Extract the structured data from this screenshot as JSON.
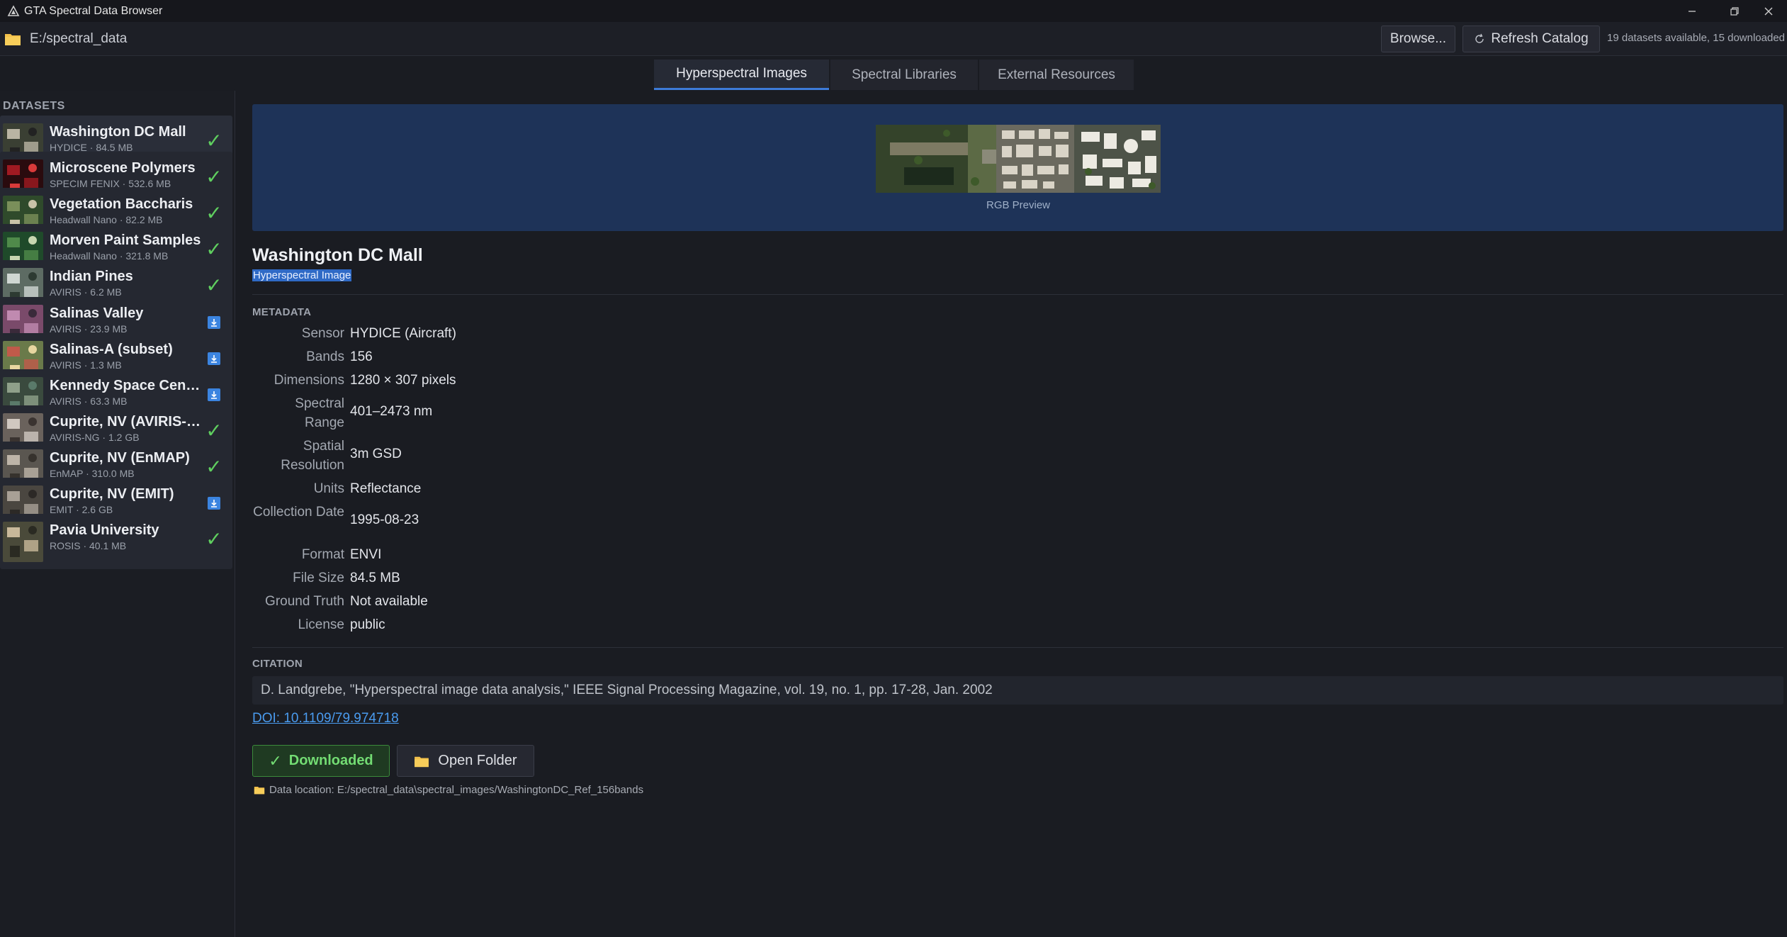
{
  "window": {
    "title": "GTA Spectral Data Browser"
  },
  "toolbar": {
    "path": "E:/spectral_data",
    "browse_label": "Browse...",
    "refresh_label": "Refresh Catalog",
    "status": "19 datasets available, 15 downloaded"
  },
  "tabs": [
    {
      "label": "Hyperspectral Images",
      "active": true
    },
    {
      "label": "Spectral Libraries",
      "active": false
    },
    {
      "label": "External Resources",
      "active": false
    }
  ],
  "sidebar": {
    "heading": "DATASETS",
    "items": [
      {
        "name": "Washington DC Mall",
        "meta": "HYDICE · 84.5 MB",
        "status": "downloaded",
        "selected": true
      },
      {
        "name": "Microscene Polymers",
        "meta": "SPECIM FENIX · 532.6 MB",
        "status": "downloaded"
      },
      {
        "name": "Vegetation Baccharis",
        "meta": "Headwall Nano · 82.2 MB",
        "status": "downloaded"
      },
      {
        "name": "Morven Paint Samples",
        "meta": "Headwall Nano · 321.8 MB",
        "status": "downloaded"
      },
      {
        "name": "Indian Pines",
        "meta": "AVIRIS · 6.2 MB",
        "status": "downloaded"
      },
      {
        "name": "Salinas Valley",
        "meta": "AVIRIS · 23.9 MB",
        "status": "download"
      },
      {
        "name": "Salinas-A (subset)",
        "meta": "AVIRIS · 1.3 MB",
        "status": "download"
      },
      {
        "name": "Kennedy Space Center",
        "meta": "AVIRIS · 63.3 MB",
        "status": "download"
      },
      {
        "name": "Cuprite, NV (AVIRIS-NG)",
        "meta": "AVIRIS-NG · 1.2 GB",
        "status": "downloaded"
      },
      {
        "name": "Cuprite, NV (EnMAP)",
        "meta": "EnMAP · 310.0 MB",
        "status": "downloaded"
      },
      {
        "name": "Cuprite, NV (EMIT)",
        "meta": "EMIT · 2.6 GB",
        "status": "download"
      },
      {
        "name": "Pavia University",
        "meta": "ROSIS · 40.1 MB",
        "status": "downloaded"
      }
    ]
  },
  "detail": {
    "preview_caption": "RGB Preview",
    "title": "Washington DC Mall",
    "type_badge": "Hyperspectral Image",
    "metadata_heading": "METADATA",
    "metadata": [
      {
        "label": "Sensor",
        "value": "HYDICE (Aircraft)"
      },
      {
        "label": "Bands",
        "value": "156"
      },
      {
        "label": "Dimensions",
        "value": "1280 × 307 pixels"
      },
      {
        "label": "Spectral Range",
        "value": "401–2473 nm"
      },
      {
        "label": "Spatial Resolution",
        "value": "3m GSD"
      },
      {
        "label": "Units",
        "value": "Reflectance"
      },
      {
        "label": "Collection Date",
        "value": "1995-08-23"
      },
      {
        "label": "Format",
        "value": "ENVI"
      },
      {
        "label": "File Size",
        "value": "84.5 MB"
      },
      {
        "label": "Ground Truth",
        "value": "Not available"
      },
      {
        "label": "License",
        "value": "public"
      }
    ],
    "citation_heading": "CITATION",
    "citation": "D. Landgrebe, \"Hyperspectral image data analysis,\" IEEE Signal Processing Magazine, vol. 19, no. 1, pp. 17-28, Jan. 2002",
    "doi": "DOI: 10.1109/79.974718",
    "downloaded_label": "Downloaded",
    "open_folder_label": "Open Folder",
    "data_location": "Data location: E:/spectral_data\\spectral_images/WashingtonDC_Ref_156bands"
  },
  "colors": {
    "accent": "#3d7bd8",
    "success": "#5fcf5f",
    "preview_band": "#1e3358"
  }
}
